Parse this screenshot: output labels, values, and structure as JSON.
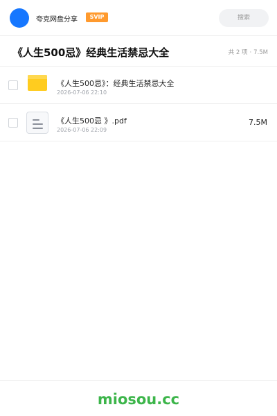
{
  "header": {
    "user_name": "夸克网盘分享",
    "vip_label": "SVIP",
    "search_placeholder": "搜索"
  },
  "title_bar": {
    "title": "《人生500忌》经典生活禁忌大全",
    "item_count": "共 2 项",
    "separator": "·",
    "total_size": "7.5M"
  },
  "files": [
    {
      "name": "《人生500忌》：经典生活禁忌大全",
      "date": "2026-07-06 22:10",
      "size": "",
      "icon": "folder-icon"
    },
    {
      "name": "《人生500忌 》.pdf",
      "date": "2026-07-06 22:09",
      "size": "7.5M",
      "icon": "document-icon"
    }
  ],
  "footer": {
    "watermark": "miosou.cc"
  },
  "colors": {
    "avatar": "#1677ff",
    "vip_badge": "#ff9a2e",
    "folder": "#ffcc1f",
    "watermark": "#3cb54a"
  }
}
